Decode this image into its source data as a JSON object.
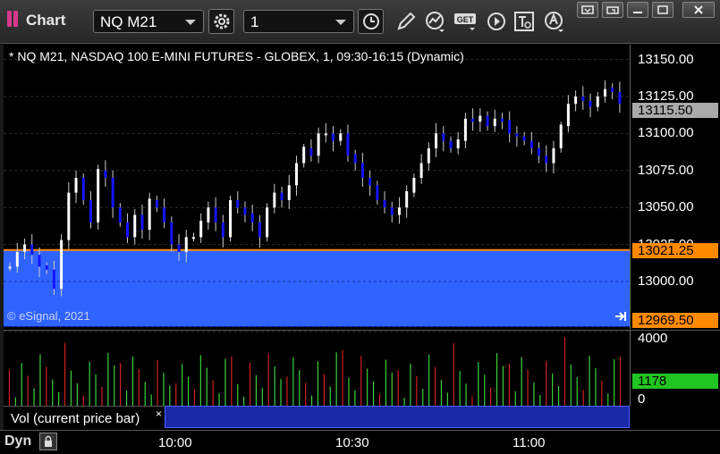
{
  "window": {
    "title": "Chart",
    "symbol_value": "NQ M21",
    "interval_value": "1"
  },
  "toolbar": {
    "icons": [
      "settings-gear-icon",
      "clock-icon",
      "pencil-icon",
      "study-chart-icon",
      "get-icon",
      "play-icon",
      "text-tool-icon",
      "alert-icon",
      "menu-icon",
      "restore-icon",
      "close-icon"
    ],
    "get_label": "GET"
  },
  "chart_header": {
    "text": "* NQ M21, NASDAQ 100 E-MINI FUTURES - GLOBEX, 1, 09:30-16:15 (Dynamic)"
  },
  "copyright": "© eSignal, 2021",
  "legend": {
    "label": "Vol (current price bar)",
    "close_glyph": "×"
  },
  "bottom": {
    "mode": "Dyn",
    "lock_icon": "lock-icon"
  },
  "colors": {
    "up": "#ffffff",
    "down": "#1414ff",
    "vol_up": "#3bd23b",
    "vol_down": "#d22020",
    "blue_zone": "#2f63ff",
    "orange": "#ff8a00",
    "current_price_tag": "#aaaaaa",
    "volume_tag": "#21c521"
  },
  "chart_data": [
    {
      "type": "candlestick",
      "title": "* NQ M21, NASDAQ 100 E-MINI FUTURES - GLOBEX, 1, 09:30-16:15 (Dynamic)",
      "y_ticks": [
        "13150.00",
        "13125.00",
        "13100.00",
        "13075.00",
        "13050.00",
        "13025.00",
        "13000.00"
      ],
      "ylim": [
        12968,
        13160
      ],
      "x_ticks": [
        "10:00",
        "10:30",
        "11:00"
      ],
      "bars_count": 100,
      "close_path": [
        13010,
        13020,
        13025,
        13018,
        13010,
        13008,
        12995,
        13028,
        13060,
        13070,
        13055,
        13040,
        13075,
        13070,
        13050,
        13040,
        13030,
        13045,
        13035,
        13055,
        13050,
        13040,
        13025,
        13020,
        13030,
        13030,
        13040,
        13050,
        13040,
        13030,
        13055,
        13050,
        13045,
        13040,
        13030,
        13050,
        13060,
        13055,
        13065,
        13080,
        13090,
        13085,
        13100,
        13100,
        13095,
        13100,
        13085,
        13080,
        13070,
        13065,
        13055,
        13050,
        13045,
        13050,
        13060,
        13070,
        13080,
        13090,
        13100,
        13095,
        13090,
        13095,
        13110,
        13108,
        13112,
        13105,
        13110,
        13108,
        13100,
        13098,
        13095,
        13090,
        13085,
        13080,
        13090,
        13105,
        13120,
        13125,
        13122,
        13118,
        13125,
        13130,
        13128,
        13120
      ],
      "reference_lines": [
        {
          "label": "13021.25",
          "color": "#ff8a00",
          "value": 13021.25
        },
        {
          "label": "12969.50",
          "color": "#ff8a00",
          "value": 12969.5
        }
      ],
      "current_price": "13115.50"
    },
    {
      "type": "bar",
      "title": "Vol (current price bar)",
      "y_ticks": [
        "4000",
        "0"
      ],
      "ylim": [
        0,
        4000
      ],
      "current_value": "1178",
      "bars_count": 100
    }
  ]
}
